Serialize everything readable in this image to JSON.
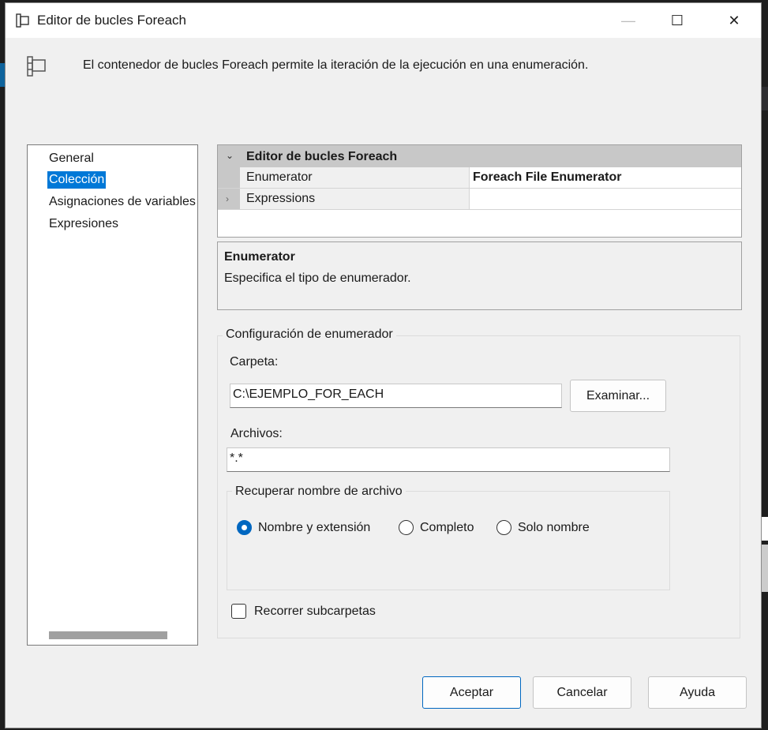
{
  "window": {
    "title": "Editor de bucles Foreach",
    "minimize_glyph": "—",
    "maximize_glyph": "☐",
    "close_glyph": "✕"
  },
  "header": {
    "description": "El contenedor de bucles Foreach permite la iteración de la ejecución en una enumeración.",
    "icon": "foreach-container-icon"
  },
  "nav": {
    "items": [
      {
        "label": "General",
        "selected": false
      },
      {
        "label": "Colección",
        "selected": true
      },
      {
        "label": "Asignaciones de variables",
        "selected": false
      },
      {
        "label": "Expresiones",
        "selected": false
      }
    ]
  },
  "property_grid": {
    "category": "Editor de bucles Foreach",
    "rows": [
      {
        "name": "Enumerator",
        "value": "Foreach File Enumerator"
      },
      {
        "name": "Expressions",
        "value": ""
      }
    ]
  },
  "description_panel": {
    "title": "Enumerator",
    "body": "Especifica el tipo de enumerador."
  },
  "enumerator_config": {
    "legend": "Configuración de enumerador",
    "folder_label": "Carpeta:",
    "folder_value": "C:\\EJEMPLO_FOR_EACH",
    "browse_label": "Examinar...",
    "files_label": "Archivos:",
    "files_value": "*.*",
    "retrieve_legend": "Recuperar nombre de archivo",
    "radio_options": [
      {
        "label": "Nombre y extensión",
        "checked": true
      },
      {
        "label": "Completo",
        "checked": false
      },
      {
        "label": "Solo nombre",
        "checked": false
      }
    ],
    "subfolders_label": "Recorrer subcarpetas",
    "subfolders_checked": false
  },
  "footer": {
    "ok_label": "Aceptar",
    "cancel_label": "Cancelar",
    "help_label": "Ayuda"
  },
  "colors": {
    "accent": "#0078d7",
    "dialog_bg": "#f0f0f0"
  }
}
